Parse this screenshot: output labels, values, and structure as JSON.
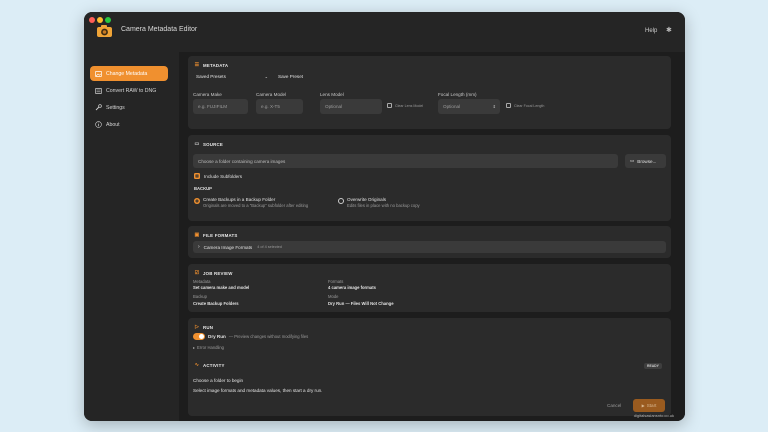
{
  "window": {
    "title": "Camera Metadata Editor",
    "help_label": "Help",
    "footer_text": "digitalsasiansnto.co.uk"
  },
  "sidebar": {
    "items": [
      {
        "label": "Change Metadata",
        "icon": "photo-icon",
        "active": true
      },
      {
        "label": "Convert RAW to DNG",
        "icon": "convert-icon",
        "active": false
      },
      {
        "label": "Settings",
        "icon": "wrench-icon",
        "active": false
      },
      {
        "label": "About",
        "icon": "info-icon",
        "active": false
      }
    ]
  },
  "metadata": {
    "header": "METADATA",
    "saved_presets": "Saved Presets",
    "save_preset": "Save Preset",
    "camera_make_label": "Camera Make",
    "camera_make_placeholder": "e.g. FUJIFILM",
    "camera_model_label": "Camera Model",
    "camera_model_placeholder": "e.g. X-T5",
    "lens_model_label": "Lens Model",
    "lens_model_placeholder": "Optional",
    "clear_lens_model": "Clear Lens Model",
    "focal_length_label": "Focal Length (mm)",
    "focal_length_placeholder": "Optional",
    "clear_focal_length": "Clear Focal Length"
  },
  "source": {
    "header": "SOURCE",
    "folder_placeholder": "Choose a folder containing camera images",
    "browse_label": "Browse...",
    "include_subfolders": "Include Subfolders",
    "backup_header": "BACKUP",
    "backup_option1_title": "Create Backups in a Backup Folder",
    "backup_option1_desc": "Originals are moved to a \"Backup\" subfolder after editing",
    "backup_option2_title": "Overwrite Originals",
    "backup_option2_desc": "Edits files in place with no backup copy"
  },
  "file_formats": {
    "header": "FILE FORMATS",
    "row_label": "Camera Image Formats",
    "row_count": "4 of 4 selected"
  },
  "job_review": {
    "header": "JOB REVIEW",
    "metadata_label": "Metadata",
    "metadata_value": "Set camera make and model",
    "formats_label": "Formats",
    "formats_value": "4 camera image formats",
    "backup_label": "Backup",
    "backup_value": "Create Backup Folders",
    "mode_label": "Mode",
    "mode_value": "Dry Run — Files Will Not Change"
  },
  "run": {
    "header": "RUN",
    "dry_run_label": "Dry Run",
    "dry_run_desc": "— Preview changes without modifying files",
    "error_handling": "Error Handling",
    "activity_header": "ACTIVITY",
    "ready_badge": "READY",
    "status_line1": "Choose a folder to begin",
    "status_line2": "Select image formats and metadata values, then start a dry run.",
    "cancel_label": "Cancel",
    "start_label": "Start"
  }
}
